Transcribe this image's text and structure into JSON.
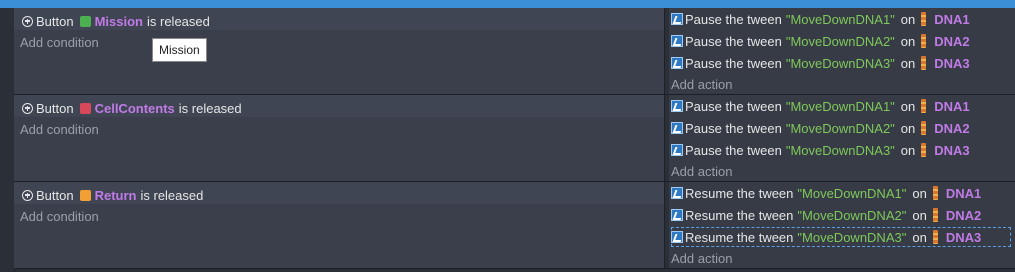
{
  "events": [
    {
      "condition": {
        "kind": "Button",
        "object": "Mission",
        "suffix": "is released",
        "icon_color": "#4caf50"
      },
      "add_condition": "Add condition",
      "actions": [
        {
          "verb": "Pause the tween",
          "tween": "\"MoveDownDNA1\"",
          "on": "on",
          "target": "DNA1"
        },
        {
          "verb": "Pause the tween",
          "tween": "\"MoveDownDNA2\"",
          "on": "on",
          "target": "DNA2"
        },
        {
          "verb": "Pause the tween",
          "tween": "\"MoveDownDNA3\"",
          "on": "on",
          "target": "DNA3"
        }
      ],
      "add_action": "Add action"
    },
    {
      "condition": {
        "kind": "Button",
        "object": "CellContents",
        "suffix": "is released",
        "icon_color": "#d9475a"
      },
      "add_condition": "Add condition",
      "actions": [
        {
          "verb": "Pause the tween",
          "tween": "\"MoveDownDNA1\"",
          "on": "on",
          "target": "DNA1"
        },
        {
          "verb": "Pause the tween",
          "tween": "\"MoveDownDNA2\"",
          "on": "on",
          "target": "DNA2"
        },
        {
          "verb": "Pause the tween",
          "tween": "\"MoveDownDNA3\"",
          "on": "on",
          "target": "DNA3"
        }
      ],
      "add_action": "Add action"
    },
    {
      "condition": {
        "kind": "Button",
        "object": "Return",
        "suffix": "is released",
        "icon_color": "#f2a033"
      },
      "add_condition": "Add condition",
      "actions": [
        {
          "verb": "Resume the tween",
          "tween": "\"MoveDownDNA1\"",
          "on": "on",
          "target": "DNA1"
        },
        {
          "verb": "Resume the tween",
          "tween": "\"MoveDownDNA2\"",
          "on": "on",
          "target": "DNA2"
        },
        {
          "verb": "Resume the tween",
          "tween": "\"MoveDownDNA3\"",
          "on": "on",
          "target": "DNA3"
        }
      ],
      "add_action": "Add action"
    }
  ],
  "tooltip": "Mission",
  "icons": {
    "condition": "plus-circle-icon",
    "action": "tween-icon",
    "object": "dna-sprite-icon"
  }
}
